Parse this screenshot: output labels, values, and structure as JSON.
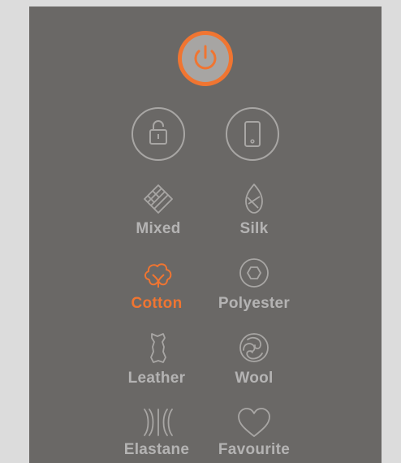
{
  "colors": {
    "panel": "#6a6866",
    "background": "#dcdcdc",
    "accent": "#f07531",
    "inactive": "#cfcfcf"
  },
  "power": {
    "icon": "power-icon",
    "state": "on"
  },
  "top_controls": [
    {
      "name": "lock",
      "icon": "unlock-icon"
    },
    {
      "name": "phone",
      "icon": "phone-icon"
    }
  ],
  "programs": [
    {
      "label": "Mixed",
      "icon": "mixed-fabric-icon",
      "active": false
    },
    {
      "label": "Silk",
      "icon": "silk-icon",
      "active": false
    },
    {
      "label": "Cotton",
      "icon": "cotton-icon",
      "active": true
    },
    {
      "label": "Polyester",
      "icon": "polyester-icon",
      "active": false
    },
    {
      "label": "Leather",
      "icon": "leather-icon",
      "active": false
    },
    {
      "label": "Wool",
      "icon": "wool-icon",
      "active": false
    },
    {
      "label": "Elastane",
      "icon": "elastane-icon",
      "active": false
    },
    {
      "label": "Favourite",
      "icon": "heart-icon",
      "active": false
    }
  ]
}
